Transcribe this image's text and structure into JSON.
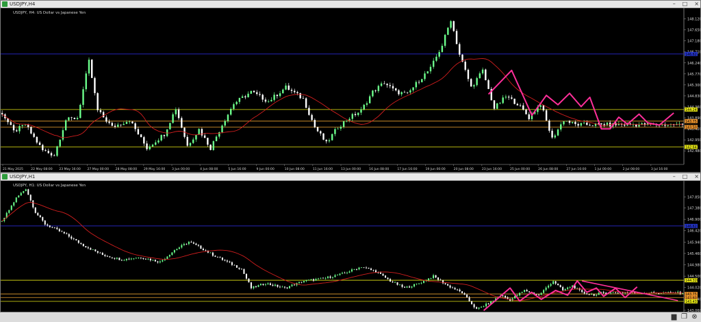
{
  "colors": {
    "bull": "#6cff8c",
    "bear": "#ffffff",
    "ma": "#d21e1e",
    "hline_yellow": "#e6e614",
    "hline_orange": "#e8a030",
    "hline_blue": "#2a2acc",
    "drawing": "#ff2f9a",
    "bg": "#000000",
    "text": "#d8d8d8"
  },
  "windows": [
    {
      "title": "USDJPY,H4",
      "controls": [
        "–",
        "□",
        "×"
      ],
      "chart_data": {
        "type": "candlestick",
        "symbol": "USDJPY",
        "timeframe": "H4",
        "label": "USDJPY, H4:  US Dollar vs Japanese Yen",
        "price_range": [
          141.9,
          148.4
        ],
        "y_ticks": [
          "148.120",
          "147.650",
          "147.180",
          "146.710",
          "146.240",
          "145.770",
          "145.300",
          "144.830",
          "144.360",
          "143.890",
          "143.420",
          "142.950",
          "142.480"
        ],
        "x_ticks": [
          "21 May 2025",
          "22 May 08:00",
          "23 May 16:00",
          "27 May 00:00",
          "28 May 08:00",
          "29 May 16:00",
          "3 Jun 00:00",
          "4 Jun 08:00",
          "5 Jun 16:00",
          "9 Jun 00:00",
          "10 Jun 08:00",
          "11 Jun 16:00",
          "13 Jun 00:00",
          "16 Jun 08:00",
          "17 Jun 16:00",
          "19 Jun 00:00",
          "20 Jun 08:00",
          "23 Jun 16:00",
          "25 Jun 00:00",
          "26 Jun 08:00",
          "27 Jun 16:00",
          "1 Jul 00:00",
          "2 Jul 08:00",
          "3 Jul 16:00"
        ],
        "hlines": [
          {
            "price": 146.62,
            "color": "blue",
            "label": "146.62"
          },
          {
            "price": 144.247,
            "color": "yellow",
            "label": "144.247"
          },
          {
            "price": 143.75,
            "color": "orange",
            "label": "143.75"
          },
          {
            "price": 143.5,
            "color": "orange",
            "label": "143.50"
          },
          {
            "price": 142.647,
            "color": "yellow",
            "label": "142.647"
          }
        ],
        "anchors": [
          [
            0,
            144.1
          ],
          [
            4,
            143.3
          ],
          [
            8,
            143.6
          ],
          [
            14,
            142.5
          ],
          [
            18,
            142.3
          ],
          [
            22,
            143.8
          ],
          [
            26,
            143.9
          ],
          [
            30,
            146.3
          ],
          [
            33,
            144.2
          ],
          [
            38,
            143.5
          ],
          [
            44,
            143.8
          ],
          [
            50,
            142.6
          ],
          [
            56,
            143.2
          ],
          [
            60,
            144.3
          ],
          [
            64,
            142.7
          ],
          [
            68,
            143.4
          ],
          [
            72,
            142.6
          ],
          [
            76,
            143.6
          ],
          [
            80,
            144.5
          ],
          [
            86,
            145.0
          ],
          [
            92,
            144.6
          ],
          [
            98,
            145.2
          ],
          [
            104,
            144.7
          ],
          [
            108,
            143.5
          ],
          [
            112,
            142.8
          ],
          [
            116,
            143.5
          ],
          [
            120,
            143.9
          ],
          [
            124,
            144.2
          ],
          [
            128,
            145.0
          ],
          [
            132,
            145.4
          ],
          [
            136,
            145.0
          ],
          [
            140,
            144.9
          ],
          [
            144,
            145.5
          ],
          [
            148,
            146.0
          ],
          [
            152,
            147.0
          ],
          [
            155,
            148.1
          ],
          [
            158,
            146.6
          ],
          [
            162,
            145.2
          ],
          [
            166,
            145.9
          ],
          [
            170,
            144.3
          ],
          [
            174,
            144.8
          ],
          [
            178,
            144.5
          ],
          [
            182,
            143.9
          ],
          [
            186,
            144.5
          ],
          [
            190,
            143.0
          ],
          [
            194,
            143.8
          ],
          [
            198,
            143.6
          ],
          [
            200,
            143.6
          ]
        ],
        "pattern": [
          [
            168,
            144.9
          ],
          [
            176,
            145.92
          ],
          [
            183,
            144.0
          ],
          [
            188,
            144.85
          ],
          [
            192,
            144.45
          ],
          [
            196,
            144.94
          ],
          [
            200,
            144.37
          ],
          [
            203,
            144.77
          ],
          [
            207,
            143.42
          ],
          [
            210,
            143.42
          ],
          [
            213,
            143.92
          ],
          [
            216,
            143.62
          ],
          [
            220,
            144.05
          ],
          [
            223,
            143.68
          ],
          [
            227,
            143.58
          ],
          [
            232,
            144.1
          ]
        ]
      }
    },
    {
      "title": "USDJPY,H1",
      "controls": [
        "–",
        "□",
        "×"
      ],
      "chart_data": {
        "type": "candlestick",
        "symbol": "USDJPY",
        "timeframe": "H1",
        "label": "USDJPY, H1:  US Dollar vs Japanese Yen",
        "price_range": [
          143.0,
          148.35
        ],
        "y_ticks": [
          "147.850",
          "147.380",
          "146.900",
          "146.420",
          "145.940",
          "145.460",
          "144.980",
          "144.500",
          "144.020",
          "143.540",
          "143.060"
        ],
        "x_ticks": [],
        "hlines": [
          {
            "price": 146.62,
            "color": "blue",
            "label": "146.62"
          },
          {
            "price": 144.328,
            "color": "yellow",
            "label": "144.328"
          },
          {
            "price": 143.75,
            "color": "orange",
            "label": "143.75"
          },
          {
            "price": 143.6,
            "color": "orange",
            "label": "143.60"
          },
          {
            "price": 143.437,
            "color": "yellow",
            "label": "143.437"
          }
        ],
        "anchors": [
          [
            0,
            146.8
          ],
          [
            6,
            147.8
          ],
          [
            10,
            148.2
          ],
          [
            14,
            147.2
          ],
          [
            18,
            146.7
          ],
          [
            26,
            146.3
          ],
          [
            34,
            145.8
          ],
          [
            42,
            145.4
          ],
          [
            50,
            145.2
          ],
          [
            58,
            145.3
          ],
          [
            66,
            145.1
          ],
          [
            72,
            145.6
          ],
          [
            78,
            145.95
          ],
          [
            82,
            145.75
          ],
          [
            88,
            145.4
          ],
          [
            94,
            145.1
          ],
          [
            100,
            144.8
          ],
          [
            104,
            144.0
          ],
          [
            110,
            144.2
          ],
          [
            118,
            144.0
          ],
          [
            126,
            144.3
          ],
          [
            134,
            144.4
          ],
          [
            142,
            144.6
          ],
          [
            150,
            144.9
          ],
          [
            156,
            144.7
          ],
          [
            162,
            144.3
          ],
          [
            168,
            144.0
          ],
          [
            174,
            144.2
          ],
          [
            180,
            144.5
          ],
          [
            186,
            144.1
          ],
          [
            192,
            143.8
          ],
          [
            198,
            143.1
          ],
          [
            204,
            143.4
          ],
          [
            208,
            143.7
          ],
          [
            212,
            143.5
          ],
          [
            218,
            143.9
          ],
          [
            224,
            143.7
          ],
          [
            230,
            144.3
          ],
          [
            234,
            143.9
          ],
          [
            238,
            144.1
          ],
          [
            242,
            143.8
          ],
          [
            248,
            143.7
          ],
          [
            250,
            143.8
          ]
        ],
        "pattern": [
          [
            201,
            143.05
          ],
          [
            212,
            144.0
          ],
          [
            216,
            143.45
          ],
          [
            221,
            143.82
          ],
          [
            225,
            143.52
          ],
          [
            231,
            143.9
          ],
          [
            236,
            143.7
          ],
          [
            240,
            144.3
          ],
          [
            244,
            143.82
          ],
          [
            248,
            144.0
          ],
          [
            251,
            143.65
          ],
          [
            256,
            143.99
          ],
          [
            260,
            143.6
          ],
          [
            265,
            144.05
          ]
        ],
        "trendline": [
          [
            242,
            144.3
          ],
          [
            282,
            143.47
          ]
        ]
      }
    }
  ]
}
